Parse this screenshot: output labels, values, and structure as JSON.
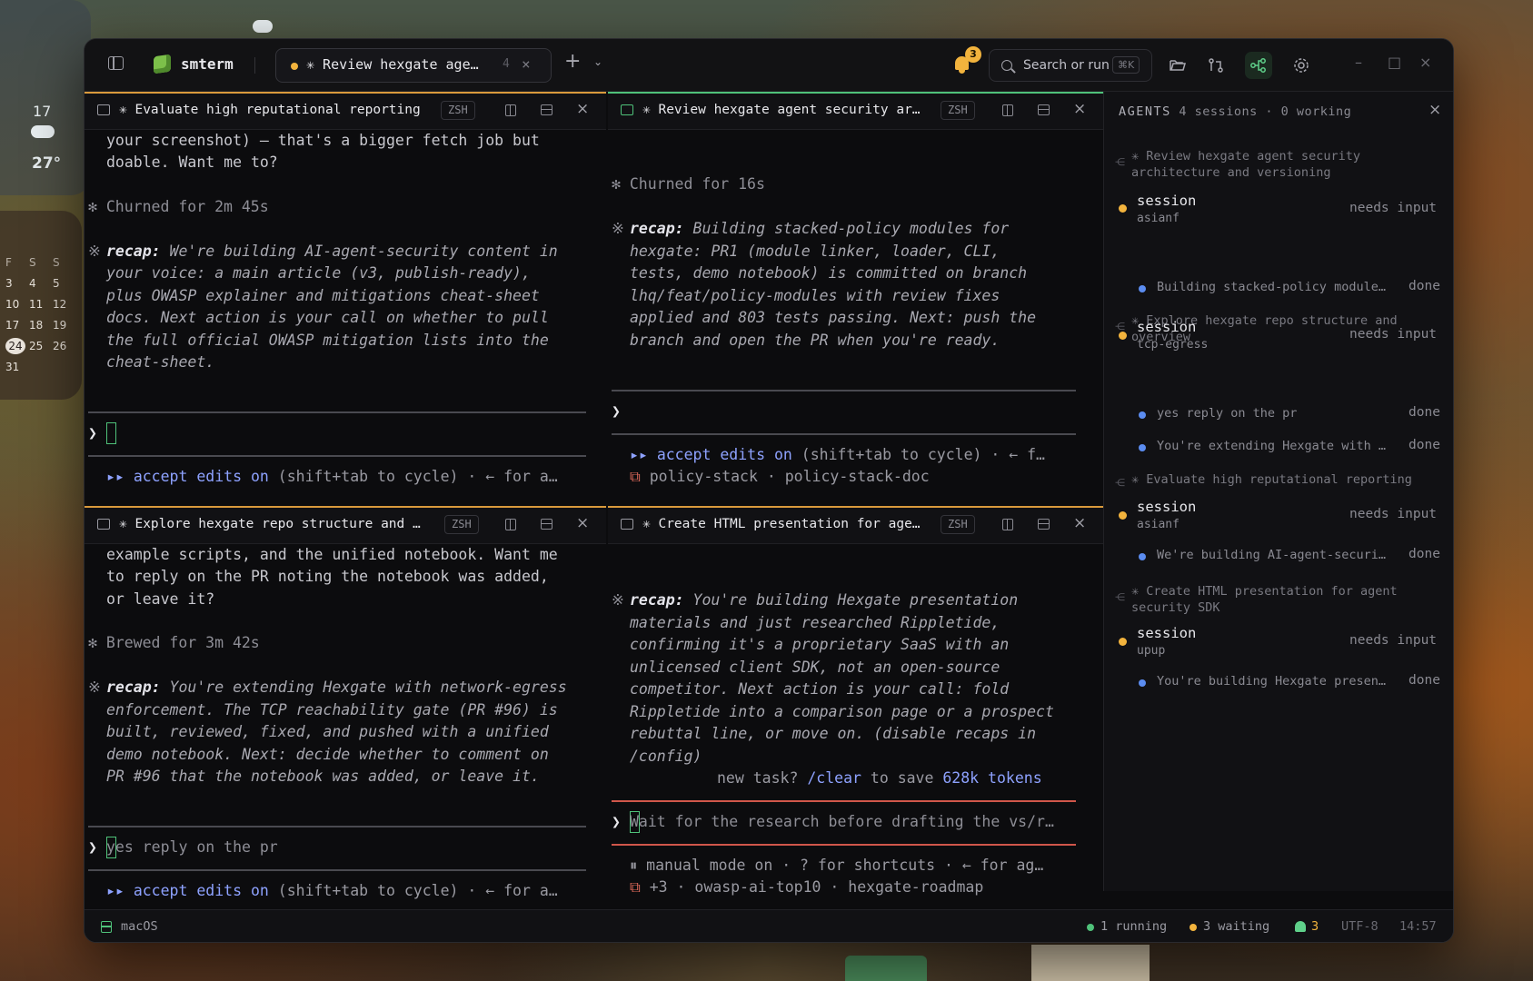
{
  "desktop": {
    "weather_temp_a": "17",
    "weather_temp_b": "27°",
    "calendar_header": [
      "F",
      "S",
      "S"
    ],
    "calendar_rows": [
      [
        "3",
        "4",
        "5"
      ],
      [
        "10",
        "11",
        "12"
      ],
      [
        "17",
        "18",
        "19"
      ],
      [
        "24",
        "25",
        "26"
      ],
      [
        "31",
        "",
        ""
      ]
    ],
    "calendar_today": "24"
  },
  "titlebar": {
    "app_name": "smterm",
    "active_tab": {
      "label": "✳ Review hexgate age…",
      "count": "4",
      "close": "×"
    },
    "new_tab": "+",
    "tab_menu": "⌄",
    "notifications_count": "3",
    "search": {
      "placeholder": "Search or run",
      "shortcut": "⌘K"
    },
    "window_controls": {
      "minimize": "–",
      "maximize": "□",
      "close": "×"
    }
  },
  "panes": {
    "top_left": {
      "title": "✳ Evaluate high reputational reporting",
      "shell": "ZSH",
      "lines": [
        "your screenshot) — that's a bigger fetch job but",
        "doable. Want me to?"
      ],
      "churned": "✻ Churned for 2m 45s",
      "recap_label": "recap:",
      "recap_lines": [
        " We're building AI-agent-security content in",
        "your voice: a main article (v3, publish-ready),",
        "plus OWASP explainer and mitigations cheat-sheet",
        "docs. Next action is your call on whether to pull",
        "the full official OWASP mitigation lists into the",
        "cheat-sheet."
      ],
      "prompt": "❯",
      "prompt_value": "",
      "mode_accept": "accept edits on",
      "mode_rest": " (shift+tab to cycle) · ← for a…"
    },
    "top_right": {
      "title": "✳ Review hexgate agent security ar…",
      "shell": "ZSH",
      "churned": "✻ Churned for 16s",
      "recap_label": "recap:",
      "recap_lines": [
        " Building stacked-policy modules for",
        "hexgate: PR1 (module linker, loader, CLI,",
        "tests, demo notebook) is committed on branch",
        "lhq/feat/policy-modules with review fixes",
        "applied and 803 tests passing. Next: push the",
        "branch and open the PR when you're ready."
      ],
      "prompt": "❯",
      "mode_accept": "accept edits on",
      "mode_rest": " (shift+tab to cycle) · ← f…",
      "branches": "policy-stack · policy-stack-doc"
    },
    "bottom_left": {
      "title": "✳ Explore hexgate repo structure and …",
      "shell": "ZSH",
      "lines": [
        "example scripts, and the unified notebook. Want me",
        "to reply on the PR noting the notebook was added,",
        "or leave it?"
      ],
      "brewed": "✻ Brewed for 3m 42s",
      "recap_label": "recap:",
      "recap_lines": [
        " You're extending Hexgate with network-egress",
        "enforcement. The TCP reachability gate (PR #96) is",
        "built, reviewed, fixed, and pushed with a unified",
        "demo notebook. Next: decide whether to comment on",
        "PR #96 that the notebook was added, or leave it."
      ],
      "prompt": "❯",
      "prompt_placeholder": "yes reply on the pr",
      "mode_accept": "accept edits on",
      "mode_rest": " (shift+tab to cycle) · ← for a…"
    },
    "bottom_right": {
      "title": "✳ Create HTML presentation for age…",
      "shell": "ZSH",
      "recap_label": "recap:",
      "recap_lines": [
        " You're building Hexgate presentation",
        "materials and just researched Rippletide,",
        "confirming it's a proprietary SaaS with an",
        "unlicensed client SDK, not an open-source",
        "competitor. Next action is your call: fold",
        "Rippletide into a comparison page or a prospect",
        "rebuttal line, or move on. (disable recaps in",
        "/config)"
      ],
      "new_task_pre": "new task? ",
      "new_task_cmd": "/clear",
      "new_task_mid": " to save ",
      "new_task_tokens": "628k tokens",
      "prompt": "❯",
      "prompt_placeholder": "Wait for the research before drafting the vs/r…",
      "mode_line": "⏸ manual mode on · ? for shortcuts · ← for ag…",
      "branches": "+3 · owasp-ai-top10 · hexgate-roadmap"
    }
  },
  "agents": {
    "title": "AGENTS",
    "summary": "4 sessions · 0 working",
    "groups": [
      {
        "name": "✳ Review hexgate agent security architecture and versioning",
        "session": "session",
        "user": "asianf",
        "status": "needs input",
        "subs": [
          {
            "text": "Building stacked-policy modules…",
            "status": "done"
          }
        ]
      },
      {
        "name": "✳ Explore hexgate repo structure and overview",
        "session": "session",
        "user": "tcp-egress",
        "status": "needs input",
        "subs": [
          {
            "text": "yes reply on the pr",
            "status": "done"
          },
          {
            "text": "You're extending Hexgate with n…",
            "status": "done"
          }
        ]
      },
      {
        "name": "✳ Evaluate high reputational reporting",
        "session": "session",
        "user": "asianf",
        "status": "needs input",
        "subs": [
          {
            "text": "We're building AI-agent-securit…",
            "status": "done"
          }
        ]
      },
      {
        "name": "✳ Create HTML presentation for agent security SDK",
        "session": "session",
        "user": "upup",
        "status": "needs input",
        "subs": [
          {
            "text": "You're building Hexgate present…",
            "status": "done"
          }
        ]
      }
    ]
  },
  "statusbar": {
    "os": "macOS",
    "running": "1 running",
    "waiting": "3 waiting",
    "bell_count": "3",
    "encoding": "UTF-8",
    "time": "14:57"
  },
  "colors": {
    "accent_orange": "#f2b33d",
    "accent_green": "#4fc27a",
    "accent_blue": "#8ea2ff",
    "background": "#0c0c0e"
  }
}
